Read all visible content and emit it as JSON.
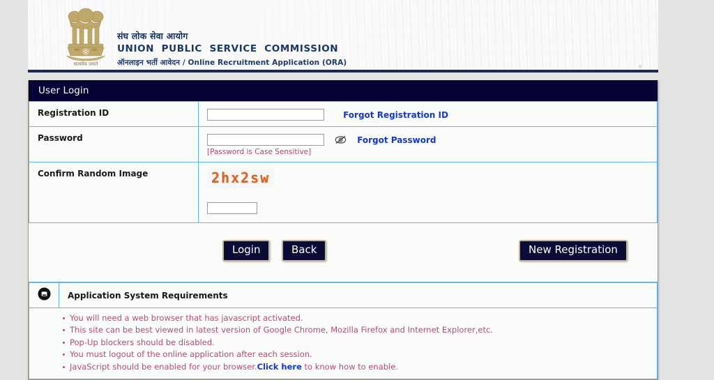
{
  "header": {
    "hindi_title": "संघ लोक सेवा आयोग",
    "english_title": "UNION  PUBLIC  SERVICE  COMMISSION",
    "sub_title": "ऑनलाइन भर्ती आवेदन / Online Recruitment Application (ORA)",
    "emblem_caption": "सत्यमेव जयते",
    "emblem_icon": "ashoka-lion-capital-emblem"
  },
  "login": {
    "panel_title": "User Login",
    "registration": {
      "label": "Registration ID",
      "value": "",
      "placeholder": "",
      "forgot_link": "Forgot Registration ID"
    },
    "password": {
      "label": "Password",
      "value": "",
      "placeholder": "",
      "toggle_icon": "eye-slash-icon",
      "forgot_link": "Forgot Password",
      "case_note": "[Password is Case Sensitive]"
    },
    "captcha": {
      "label": "Confirm Random Image",
      "image_text": "2hx2sw",
      "image_color": "#e1611d",
      "value": "",
      "placeholder": ""
    },
    "buttons": {
      "login": "Login",
      "back": "Back",
      "new_registration": "New Registration"
    }
  },
  "requirements": {
    "toggle_icon": "collapse-minus-circle-icon",
    "title": "Application System Requirements",
    "items": [
      {
        "text": "You will need a web browser that has javascript activated.",
        "link": null,
        "after": null
      },
      {
        "text": "This site can be best viewed in latest version of Google Chrome, Mozilla Firefox and Internet Explorer,etc.",
        "link": null,
        "after": null
      },
      {
        "text": "Pop-Up blockers should be disabled.",
        "link": null,
        "after": null
      },
      {
        "text": "You must logout of the online application after each session.",
        "link": null,
        "after": null
      },
      {
        "text": "JavaScript should be enabled for your browser.",
        "link": "Click here",
        "after": " to know how to enable."
      }
    ]
  },
  "colors": {
    "panel_title_bg": "#050434",
    "cell_border": "#62b6e8",
    "link": "#1437d0",
    "note_text": "#b5426c",
    "button_bg": "#0b0b38",
    "button_border": "#c5b48c",
    "page_bg": "#e3e3e3"
  }
}
